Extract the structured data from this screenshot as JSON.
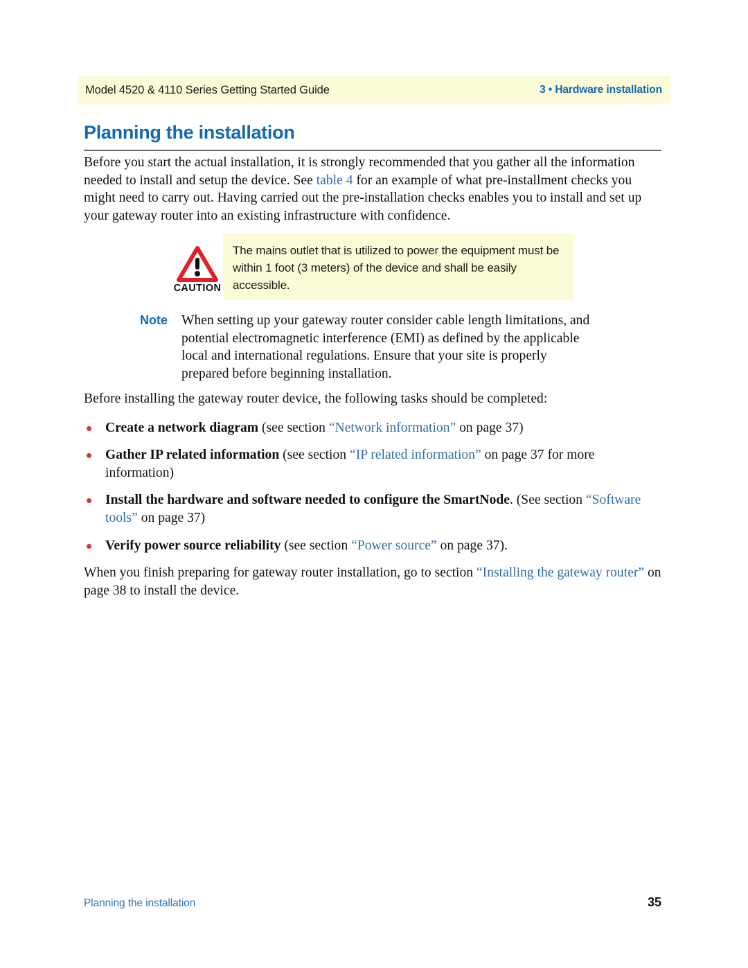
{
  "header": {
    "left_title": "Model 4520 & 4110 Series Getting Started Guide",
    "right_title": "3 • Hardware installation",
    "band_color": "#fcfbd8",
    "accent_blue": "#1369b0"
  },
  "title": {
    "text": "Planning the installation",
    "rule_color": "#6e6e6e"
  },
  "intro": {
    "part1": "Before you start the actual installation, it is strongly recommended that you gather all the information needed to install and setup the device. See ",
    "link": "table 4",
    "part2": " for an example of what pre-installment checks you might need to carry out. Having carried out the pre-installation checks enables you to install and set up your gateway router into an existing infrastructure with confidence."
  },
  "caution": {
    "icon_name": "warning-triangle-icon",
    "label": "CAUTION",
    "text": "The mains outlet that is utilized to power the equipment must be within 1 foot (3 meters) of the device and shall be easily accessible.",
    "box_color": "#fcfbd8",
    "icon_color": "#e01f26"
  },
  "note": {
    "label": "Note",
    "text": "When setting up your gateway router consider cable length limitations, and potential electromagnetic interference (EMI) as defined by the applicable local and international regulations. Ensure that your site is properly prepared before beginning installation."
  },
  "tasks": {
    "lead": "Before installing the gateway router device, the following tasks should be completed:",
    "bullet_color": "#d63b22",
    "items": [
      {
        "bold": "Create a network diagram",
        "pre": " (see section ",
        "link": "“Network information”",
        "post": " on page 37)"
      },
      {
        "bold": "Gather IP related information",
        "pre": " (see section ",
        "link": "“IP related information”",
        "post": " on page 37 for more information)"
      },
      {
        "bold": "Install the hardware and software needed to configure the SmartNode",
        "pre": ". (See section ",
        "link": "“Software tools”",
        "post": " on page 37)"
      },
      {
        "bold": "Verify power source reliability",
        "pre": " (see section ",
        "link": "“Power source”",
        "post": " on page 37)."
      }
    ]
  },
  "closing": {
    "part1": "When you finish preparing for gateway router installation, go to section ",
    "link": "“Installing the gateway router”",
    "part2": " on page 38 to install the device."
  },
  "footer": {
    "left": "Planning the installation",
    "page_number": "35",
    "link_color": "#2f76bd"
  }
}
